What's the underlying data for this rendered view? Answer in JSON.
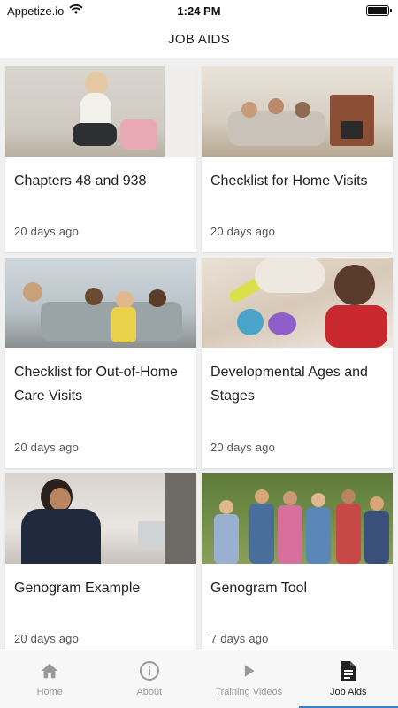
{
  "status": {
    "carrier": "Appetize.io",
    "time": "1:24 PM"
  },
  "header": {
    "title": "JOB AIDS"
  },
  "cards": [
    {
      "title": "Chapters 48 and 938",
      "date": "20 days ago"
    },
    {
      "title": "Checklist for Home Visits",
      "date": "20 days ago"
    },
    {
      "title": "Checklist for Out-of-Home Care Visits",
      "date": "20 days ago"
    },
    {
      "title": "Developmental Ages and Stages",
      "date": "20 days ago"
    },
    {
      "title": "Genogram Example",
      "date": "20 days ago"
    },
    {
      "title": "Genogram Tool",
      "date": "7 days ago"
    }
  ],
  "tabs": [
    {
      "label": "Home",
      "icon": "home-icon",
      "active": false
    },
    {
      "label": "About",
      "icon": "info-icon",
      "active": false
    },
    {
      "label": "Training Videos",
      "icon": "play-icon",
      "active": false
    },
    {
      "label": "Job Aids",
      "icon": "document-icon",
      "active": true
    }
  ],
  "colors": {
    "accent": "#3b82c4",
    "inactive": "#999999",
    "background": "#f0f0f0"
  }
}
